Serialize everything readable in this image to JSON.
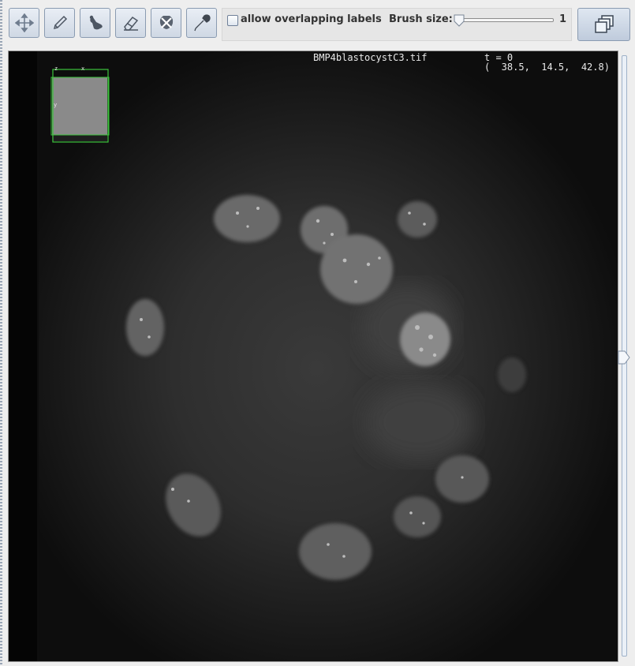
{
  "toolbar": {
    "tools": [
      {
        "id": "move",
        "icon": "move-arrows-icon"
      },
      {
        "id": "draw",
        "icon": "pencil-icon"
      },
      {
        "id": "fill",
        "icon": "fill-bucket-icon"
      },
      {
        "id": "erase",
        "icon": "eraser-icon"
      },
      {
        "id": "delete",
        "icon": "delete-label-icon"
      },
      {
        "id": "picker",
        "icon": "color-picker-icon"
      }
    ],
    "overlap_checkbox_label": "allow overlapping labels",
    "overlap_checked": false,
    "brush_size_label": "Brush size:",
    "brush_size_value": "1",
    "stack_button_icon": "layers-icon"
  },
  "viewer": {
    "title": "BMP4blastocystC3.tif",
    "time_text": "t = 0",
    "coords_text": "(  38.5,  14.5,  42.8)",
    "overview_axes": {
      "z": "z",
      "x": "x",
      "y": "y"
    }
  },
  "colors": {
    "background": "#0f0f0f",
    "overview_box": "#3cc43c",
    "overview_fill": "#8a8a8a"
  }
}
